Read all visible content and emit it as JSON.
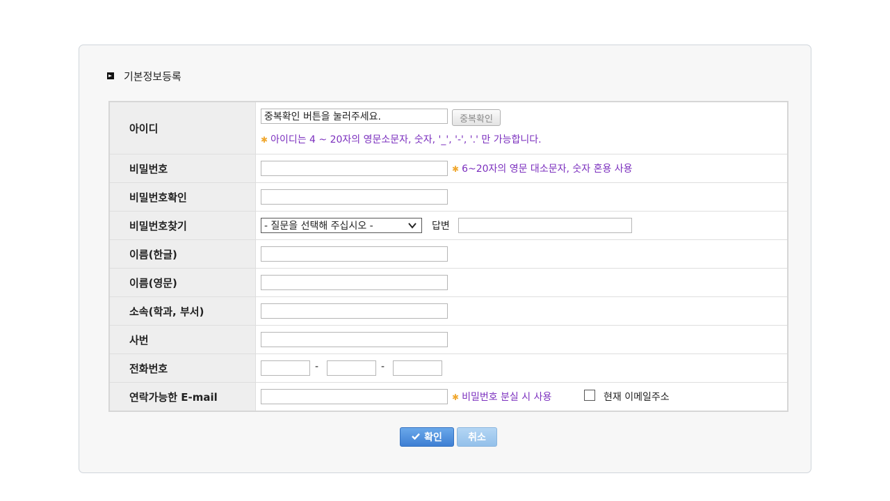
{
  "section": {
    "title": "기본정보등록"
  },
  "fields": {
    "id": {
      "label": "아이디",
      "value": "중복확인 버튼을 눌러주세요.",
      "check_button": "중복확인",
      "hint": "아이디는 4 ~ 20자의 영문소문자, 숫자, '_', '-', '.' 만 가능합니다."
    },
    "password": {
      "label": "비밀번호",
      "hint": "6~20자의 영문 대소문자, 숫자 혼용 사용"
    },
    "password_confirm": {
      "label": "비밀번호확인"
    },
    "password_find": {
      "label": "비밀번호찾기",
      "select_value": "- 질문을 선택해 주십시오 -",
      "answer_label": "답변"
    },
    "name_kr": {
      "label": "이름(한글)"
    },
    "name_en": {
      "label": "이름(영문)"
    },
    "department": {
      "label": "소속(학과, 부서)"
    },
    "employee_no": {
      "label": "사번"
    },
    "phone": {
      "label": "전화번호",
      "separator": "-"
    },
    "email": {
      "label": "연락가능한 E-mail",
      "hint": "비밀번호 분실 시 사용",
      "checkbox_label": "현재 이메일주소",
      "checked": false
    }
  },
  "buttons": {
    "ok": "확인",
    "cancel": "취소"
  },
  "icons": {
    "section": "arrow-box-icon",
    "hint_marker": "asterisk-icon",
    "ok": "check-icon",
    "select": "chevron-down-icon"
  },
  "colors": {
    "hint_text": "#7b2fbe",
    "hint_marker": "#f0a830",
    "ok_button": "#4a8ad8",
    "cancel_button": "#a5cbef"
  }
}
